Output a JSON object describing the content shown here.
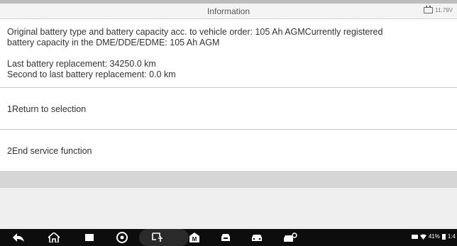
{
  "header": {
    "title": "Information",
    "battery_voltage": "11.79V"
  },
  "info": {
    "line1": "Original battery type and battery capacity acc. to vehicle order: 105 Ah AGMCurrently registered",
    "line2": "battery capacity in the DME/DDE/EDME: 105 Ah AGM",
    "line3": "Last battery replacement: 34250.0 km",
    "line4": "Second to last battery replacement: 0.0 km"
  },
  "options": [
    {
      "label": "1Return to selection"
    },
    {
      "label": "2End service function"
    }
  ],
  "status": {
    "battery_percent": "41%",
    "time": "1:4"
  },
  "nav_icons": [
    "back-icon",
    "home-icon",
    "recent-apps-icon",
    "chrome-browser-icon",
    "vci-connect-icon",
    "maintenance-m-icon",
    "car-diagnostic-icon",
    "car-service-icon",
    "car-settings-icon"
  ]
}
